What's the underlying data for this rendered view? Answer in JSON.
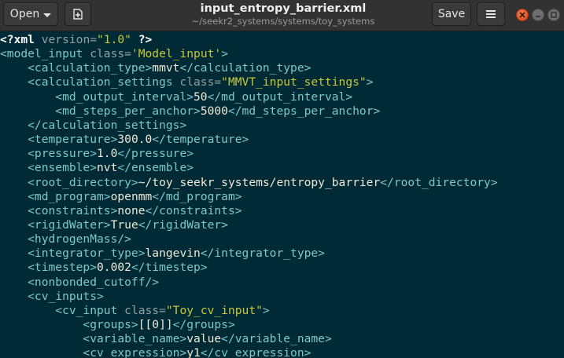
{
  "header": {
    "open_label": "Open",
    "save_label": "Save",
    "title": "input_entropy_barrier.xml",
    "path": "~/seekr2_systems/systems/toy_systems",
    "icons": {
      "open_menu": "chevron-down-icon",
      "new_document": "new-document-icon",
      "menu": "hamburger-menu-icon",
      "close": "close-icon",
      "minimize": "minimize-icon",
      "maximize": "maximize-icon"
    }
  },
  "theme": {
    "background": "#002b36",
    "tag_color": "#7ec8c8",
    "string_color": "#c8c83a",
    "close_button": "#e95420"
  },
  "code_lines": [
    [
      {
        "t": "<?xml",
        "c": "pi"
      },
      {
        "t": " version=",
        "c": "attr"
      },
      {
        "t": "\"1.0\"",
        "c": "str"
      },
      {
        "t": " ?>",
        "c": "pi"
      }
    ],
    [
      {
        "t": "<model_input",
        "c": "tag"
      },
      {
        "t": " class=",
        "c": "attr"
      },
      {
        "t": "'Model_input'",
        "c": "str"
      },
      {
        "t": ">",
        "c": "tag"
      }
    ],
    [
      {
        "t": "    <calculation_type>",
        "c": "tag"
      },
      {
        "t": "mmvt",
        "c": "txt"
      },
      {
        "t": "</calculation_type>",
        "c": "tag"
      }
    ],
    [
      {
        "t": "    <calculation_settings",
        "c": "tag"
      },
      {
        "t": " class=",
        "c": "attr"
      },
      {
        "t": "\"MMVT_input_settings\"",
        "c": "str"
      },
      {
        "t": ">",
        "c": "tag"
      }
    ],
    [
      {
        "t": "        <md_output_interval>",
        "c": "tag"
      },
      {
        "t": "50",
        "c": "txt"
      },
      {
        "t": "</md_output_interval>",
        "c": "tag"
      }
    ],
    [
      {
        "t": "        <md_steps_per_anchor>",
        "c": "tag"
      },
      {
        "t": "5000",
        "c": "txt"
      },
      {
        "t": "</md_steps_per_anchor>",
        "c": "tag"
      }
    ],
    [
      {
        "t": "    </calculation_settings>",
        "c": "tag"
      }
    ],
    [
      {
        "t": "    <temperature>",
        "c": "tag"
      },
      {
        "t": "300.0",
        "c": "txt"
      },
      {
        "t": "</temperature>",
        "c": "tag"
      }
    ],
    [
      {
        "t": "    <pressure>",
        "c": "tag"
      },
      {
        "t": "1.0",
        "c": "txt"
      },
      {
        "t": "</pressure>",
        "c": "tag"
      }
    ],
    [
      {
        "t": "    <ensemble>",
        "c": "tag"
      },
      {
        "t": "nvt",
        "c": "txt"
      },
      {
        "t": "</ensemble>",
        "c": "tag"
      }
    ],
    [
      {
        "t": "    <root_directory>",
        "c": "tag"
      },
      {
        "t": "~/toy_seekr_systems/entropy_barrier",
        "c": "txt"
      },
      {
        "t": "</root_directory>",
        "c": "tag"
      }
    ],
    [
      {
        "t": "    <md_program>",
        "c": "tag"
      },
      {
        "t": "openmm",
        "c": "txt"
      },
      {
        "t": "</md_program>",
        "c": "tag"
      }
    ],
    [
      {
        "t": "    <constraints>",
        "c": "tag"
      },
      {
        "t": "none",
        "c": "txt"
      },
      {
        "t": "</constraints>",
        "c": "tag"
      }
    ],
    [
      {
        "t": "    <rigidWater>",
        "c": "tag"
      },
      {
        "t": "True",
        "c": "txt"
      },
      {
        "t": "</rigidWater>",
        "c": "tag"
      }
    ],
    [
      {
        "t": "    <hydrogenMass/>",
        "c": "tag"
      }
    ],
    [
      {
        "t": "    <integrator_type>",
        "c": "tag"
      },
      {
        "t": "langevin",
        "c": "txt"
      },
      {
        "t": "</integrator_type>",
        "c": "tag"
      }
    ],
    [
      {
        "t": "    <timestep>",
        "c": "tag"
      },
      {
        "t": "0.002",
        "c": "txt"
      },
      {
        "t": "</timestep>",
        "c": "tag"
      }
    ],
    [
      {
        "t": "    <nonbonded_cutoff/>",
        "c": "tag"
      }
    ],
    [
      {
        "t": "    <cv_inputs>",
        "c": "tag"
      }
    ],
    [
      {
        "t": "        <cv_input",
        "c": "tag"
      },
      {
        "t": " class=",
        "c": "attr"
      },
      {
        "t": "\"Toy_cv_input\"",
        "c": "str"
      },
      {
        "t": ">",
        "c": "tag"
      }
    ],
    [
      {
        "t": "            <groups>",
        "c": "tag"
      },
      {
        "t": "[[0]]",
        "c": "txt"
      },
      {
        "t": "</groups>",
        "c": "tag"
      }
    ],
    [
      {
        "t": "            <variable_name>",
        "c": "tag"
      },
      {
        "t": "value",
        "c": "txt"
      },
      {
        "t": "</variable_name>",
        "c": "tag"
      }
    ],
    [
      {
        "t": "            <cv_expression>",
        "c": "tag"
      },
      {
        "t": "y1",
        "c": "txt"
      },
      {
        "t": "</cv_expression>",
        "c": "tag"
      }
    ]
  ]
}
